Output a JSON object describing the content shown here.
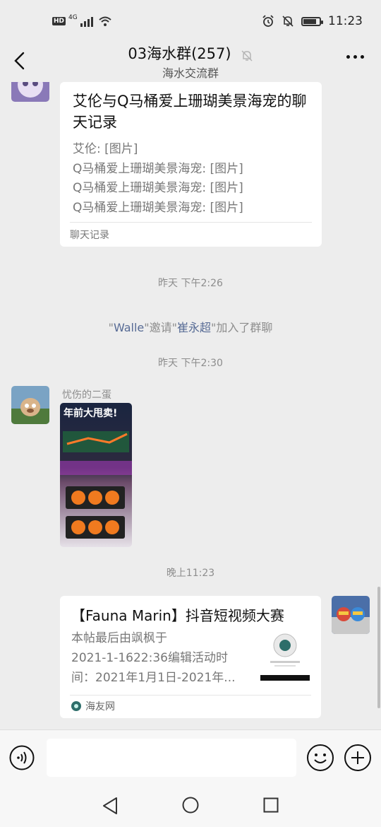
{
  "status_bar": {
    "network_badge": "HD",
    "network_type": "4G",
    "battery_level": 0.8,
    "time": "11:23"
  },
  "header": {
    "title": "03海水群(257)",
    "subtitle": "海水交流群",
    "back_icon": "chevron-left-icon",
    "mute_icon": "bell-off-icon",
    "more_icon": "more-dots-icon"
  },
  "messages": {
    "chat_record": {
      "title": "艾伦与Q马桶爱上珊瑚美景海宠的聊天记录",
      "lines": [
        "艾伦: [图片]",
        "Q马桶爱上珊瑚美景海宠: [图片]",
        "Q马桶爱上珊瑚美景海宠: [图片]",
        "Q马桶爱上珊瑚美景海宠: [图片]"
      ],
      "footer": "聊天记录"
    },
    "time1": "昨天 下午2:26",
    "system": {
      "q1": "\"",
      "inviter": "Walle",
      "q2": "\"邀请\"",
      "invitee": "崔永超",
      "q3": "\"加入了群聊"
    },
    "time2": "昨天 下午2:30",
    "image_msg": {
      "sender": "忧伤的二蛋",
      "banner": "年前大甩卖!"
    },
    "time3": "晚上11:23",
    "link_card": {
      "title": "【Fauna Marin】抖音短视频大赛",
      "desc1": "本帖最后由飒枫于",
      "desc2": "2021-1-1622:36编辑活动时",
      "desc3": "间：2021年1月1日-2021年...",
      "source": "海友网"
    }
  },
  "input_bar": {
    "voice_icon": "voice-icon",
    "emoji_icon": "emoji-icon",
    "plus_icon": "plus-icon"
  },
  "nav_bar": {
    "back_icon": "nav-back-icon",
    "home_icon": "nav-home-icon",
    "recent_icon": "nav-recent-icon"
  },
  "colors": {
    "background": "#ededed",
    "bubble": "#ffffff",
    "link_blue": "#576b95",
    "muted_text": "#8d8d8d"
  }
}
